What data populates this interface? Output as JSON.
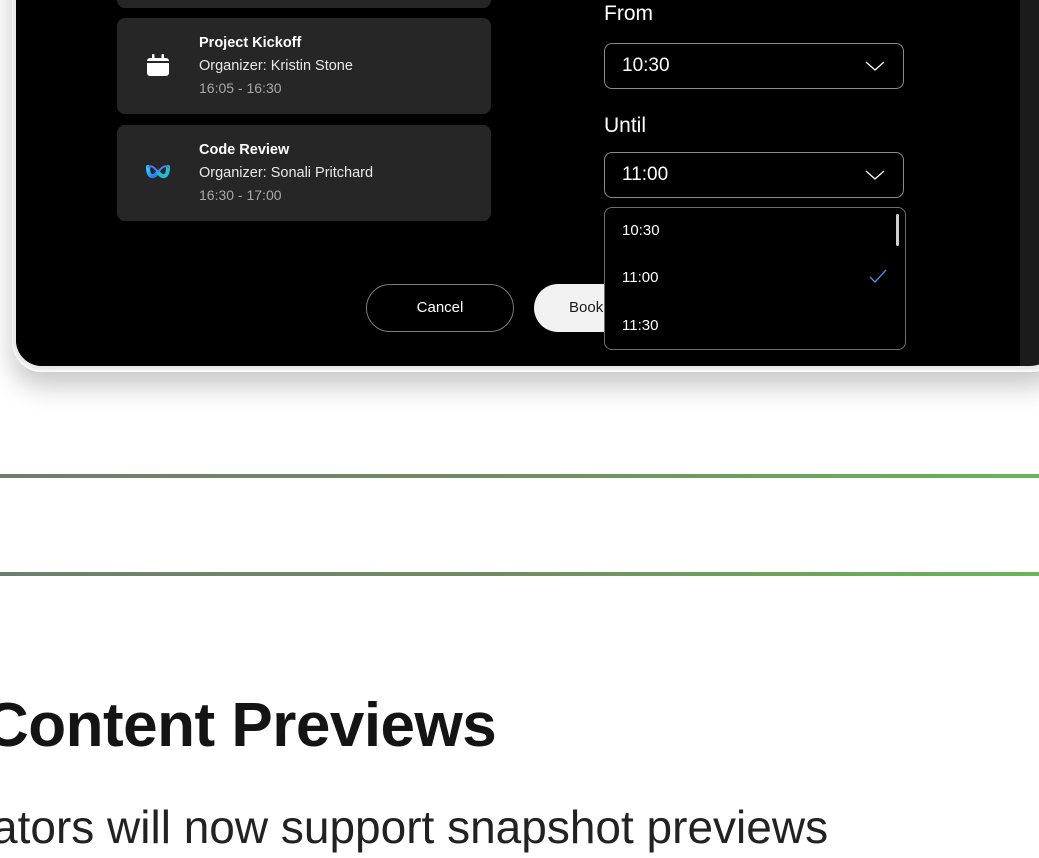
{
  "meetings": [
    {
      "title": "Project Kickoff",
      "organizer": "Organizer: Kristin Stone",
      "time": "16:05 - 16:30",
      "icon": "calendar-icon"
    },
    {
      "title": "Code Review",
      "organizer": "Organizer: Sonali Pritchard",
      "time": "16:30 - 17:00",
      "icon": "webex-icon"
    }
  ],
  "form": {
    "from_label": "From",
    "from_value": "10:30",
    "until_label": "Until",
    "until_value": "11:00",
    "until_options": [
      "10:30",
      "11:00",
      "11:30"
    ],
    "selected_option": "11:00"
  },
  "actions": {
    "cancel_label": "Cancel",
    "book_label": "Book"
  },
  "article": {
    "heading": "Content Previews",
    "body": "ators will now support snapshot previews"
  },
  "colors": {
    "accent_check": "#4a90e2",
    "divider_start": "#6e7e6e",
    "divider_end": "#6ab55a"
  }
}
